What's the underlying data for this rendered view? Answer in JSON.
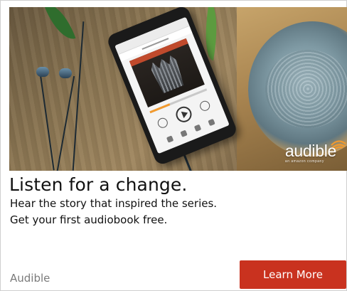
{
  "hero": {
    "logo_text": "audible",
    "logo_tagline": "an amazon company"
  },
  "phone": {
    "playback_progress": 0.35
  },
  "ad": {
    "headline": "Listen for a change.",
    "body_line_1": "Hear the story that inspired the series.",
    "body_line_2": "Get your first audiobook free.",
    "advertiser": "Audible",
    "cta_label": "Learn More"
  },
  "colors": {
    "cta_background": "#c9321f",
    "audible_orange": "#f29a2e"
  }
}
